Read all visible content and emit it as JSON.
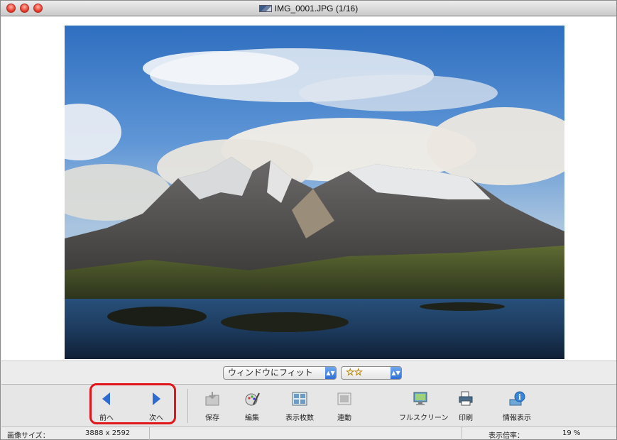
{
  "window": {
    "title": "IMG_0001.JPG (1/16)"
  },
  "viewbar": {
    "fit_select": "ウィンドウにフィット",
    "rating_stars": "☆☆"
  },
  "toolbar": {
    "prev": "前へ",
    "next": "次へ",
    "save": "保存",
    "edit": "編集",
    "display_count": "表示枚数",
    "sync": "連動",
    "fullscreen": "フルスクリーン",
    "print": "印刷",
    "info": "情報表示"
  },
  "status": {
    "image_size_label": "画像サイズ：",
    "image_size_value": "3888 x 2592",
    "zoom_label": "表示倍率：",
    "zoom_value": "19 %"
  },
  "colors": {
    "highlight": "#e0161a",
    "accent_blue": "#2e6fd6"
  }
}
